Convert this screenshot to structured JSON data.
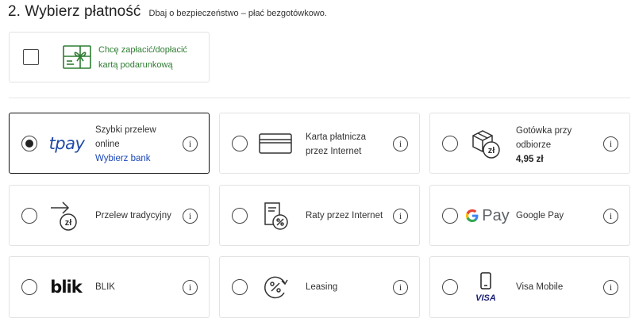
{
  "header": {
    "title": "2. Wybierz płatność",
    "subtitle": "Dbaj o bezpieczeństwo – płać bezgotówkowo."
  },
  "gift_card": {
    "line1": "Chcę zapłacić/dopłacić",
    "line2": "kartą podarunkową",
    "checked": false
  },
  "accent_colors": {
    "green": "#2e7d32",
    "blue": "#1a47b8",
    "tpay": "#1f4aa8"
  },
  "info_glyph": "i",
  "methods": [
    {
      "id": "tpay",
      "logo": "tpay",
      "line1": "Szybki przelew",
      "line2": "online",
      "link": "Wybierz bank",
      "selected": true
    },
    {
      "id": "card",
      "logo": "credit-card-icon",
      "line1": "Karta płatnicza",
      "line2": "przez Internet",
      "selected": false
    },
    {
      "id": "cod",
      "logo": "package-cash-icon",
      "icon_text": "zł",
      "line1": "Gotówka przy",
      "line2": "odbiorze",
      "price": "4,95 zł",
      "selected": false
    },
    {
      "id": "transfer",
      "logo": "arrow-transfer-icon",
      "icon_text": "zł",
      "line1": "Przelew tradycyjny",
      "selected": false
    },
    {
      "id": "installments",
      "logo": "document-percent-icon",
      "line1": "Raty przez Internet",
      "selected": false
    },
    {
      "id": "gpay",
      "logo_text": "Pay",
      "line1": "Google Pay",
      "selected": false
    },
    {
      "id": "blik",
      "logo_text": "blik",
      "line1": "BLIK",
      "selected": false
    },
    {
      "id": "leasing",
      "logo": "percent-cycle-icon",
      "line1": "Leasing",
      "selected": false
    },
    {
      "id": "visa",
      "logo": "phone-visa-icon",
      "logo_text": "VISA",
      "line1": "Visa Mobile",
      "selected": false
    }
  ]
}
